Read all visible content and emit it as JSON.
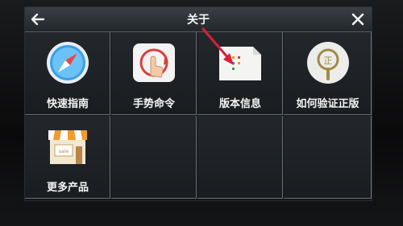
{
  "titlebar": {
    "title": "关于"
  },
  "tiles": [
    {
      "label": "快速指南",
      "icon": "compass-icon"
    },
    {
      "label": "手势命令",
      "icon": "gesture-hand-icon"
    },
    {
      "label": "版本信息",
      "icon": "document-info-icon"
    },
    {
      "label": "如何验证正版",
      "icon": "magnifier-verify-icon"
    },
    {
      "label": "更多产品",
      "icon": "store-icon"
    }
  ],
  "colors": {
    "accent_arrow": "#d8203a",
    "tile_border": "#6a7075",
    "label": "#f4f4f4"
  }
}
